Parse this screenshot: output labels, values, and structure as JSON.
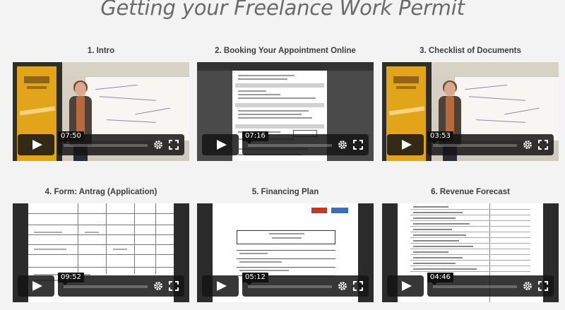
{
  "page": {
    "title": "Getting your Freelance Work Permit"
  },
  "videos": [
    {
      "title": "1. Intro",
      "duration": "07:50",
      "thumbnail": "presenter-whiteboard"
    },
    {
      "title": "2. Booking Your Appointment Online",
      "duration": "07:16",
      "thumbnail": "document-pdf"
    },
    {
      "title": "3. Checklist of Documents",
      "duration": "03:53",
      "thumbnail": "presenter-whiteboard"
    },
    {
      "title": "4. Form: Antrag (Application)",
      "duration": "09:52",
      "thumbnail": "form-table"
    },
    {
      "title": "5. Financing Plan",
      "duration": "05:12",
      "thumbnail": "financing-document"
    },
    {
      "title": "6. Revenue Forecast",
      "duration": "04:46",
      "thumbnail": "forecast-document"
    }
  ],
  "icons": {
    "play": "play-icon",
    "settings": "gear-icon",
    "fullscreen": "fullscreen-icon"
  },
  "colors": {
    "background": "#f3f3f3",
    "title": "#6a6a6a",
    "controls": "#141414"
  }
}
